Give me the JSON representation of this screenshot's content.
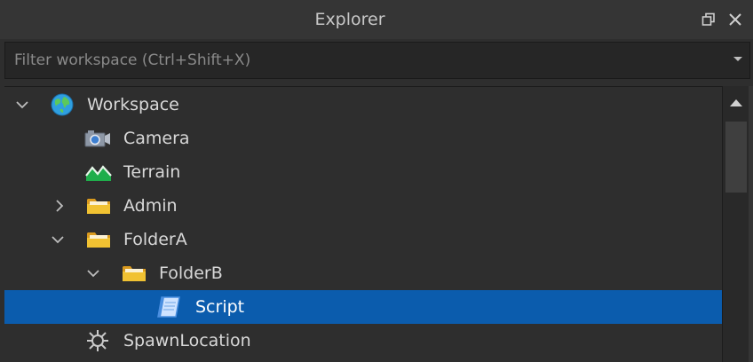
{
  "window": {
    "title": "Explorer",
    "restore_icon": "restore-icon",
    "close_icon": "close-icon"
  },
  "filter": {
    "value": "",
    "placeholder": "Filter workspace (Ctrl+Shift+X)"
  },
  "tree": {
    "items": [
      {
        "label": "Workspace",
        "icon": "workspace-globe-icon",
        "expanded": true
      },
      {
        "label": "Camera",
        "icon": "camera-icon"
      },
      {
        "label": "Terrain",
        "icon": "terrain-icon"
      },
      {
        "label": "Admin",
        "icon": "folder-icon",
        "expanded": false
      },
      {
        "label": "FolderA",
        "icon": "folder-icon",
        "expanded": true
      },
      {
        "label": "FolderB",
        "icon": "folder-icon",
        "expanded": true
      },
      {
        "label": "Script",
        "icon": "script-icon",
        "selected": true
      },
      {
        "label": "SpawnLocation",
        "icon": "spawn-location-icon"
      }
    ]
  },
  "colors": {
    "background": "#2e2e2e",
    "selection": "#0b5cad",
    "text": "#d8d8d8",
    "folder": "#f1c232"
  }
}
